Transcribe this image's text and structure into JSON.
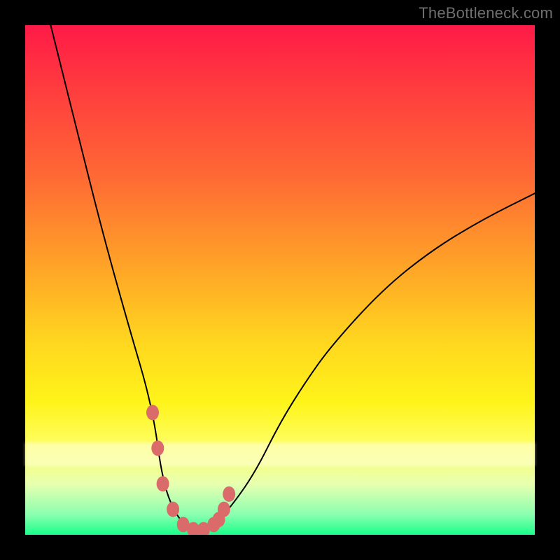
{
  "watermark": "TheBottleneck.com",
  "chart_data": {
    "type": "line",
    "title": "",
    "xlabel": "",
    "ylabel": "",
    "xlim": [
      0,
      100
    ],
    "ylim": [
      0,
      100
    ],
    "grid": false,
    "legend": false,
    "series": [
      {
        "name": "curve",
        "x": [
          5,
          10,
          15,
          20,
          25,
          27,
          30,
          33,
          35,
          37,
          40,
          45,
          50,
          55,
          60,
          70,
          80,
          90,
          100
        ],
        "y": [
          100,
          80,
          60,
          42,
          25,
          10,
          3,
          1,
          1,
          2,
          5,
          12,
          22,
          30,
          37,
          48,
          56,
          62,
          67
        ]
      }
    ],
    "markers": {
      "name": "highlighted-points",
      "color": "#db6b6b",
      "x": [
        25,
        26,
        27,
        29,
        31,
        33,
        35,
        37,
        38,
        39,
        40
      ],
      "y": [
        24,
        17,
        10,
        5,
        2,
        1,
        1,
        2,
        3,
        5,
        8
      ]
    }
  }
}
